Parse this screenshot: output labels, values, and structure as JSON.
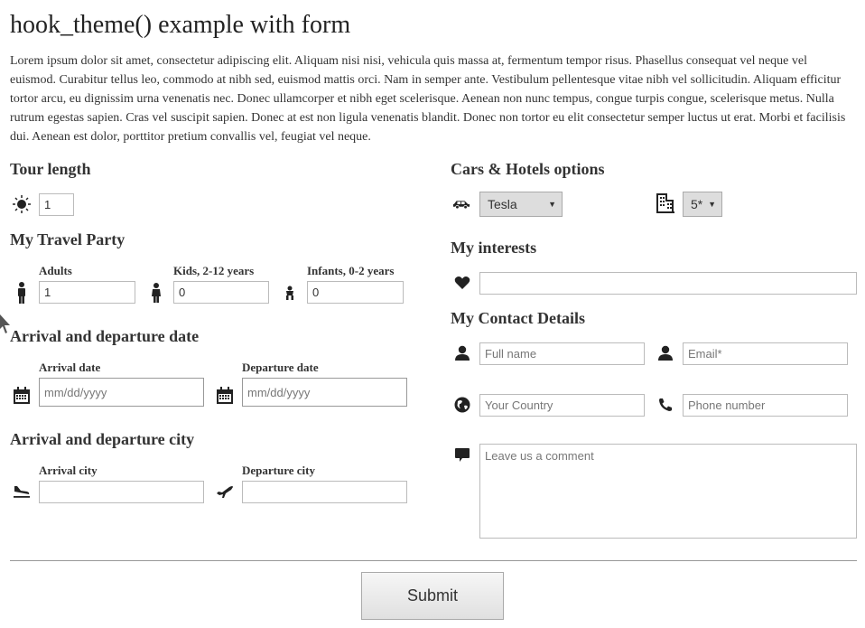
{
  "page": {
    "title": "hook_theme() example with form",
    "intro": "Lorem ipsum dolor sit amet, consectetur adipiscing elit. Aliquam nisi nisi, vehicula quis massa at, fermentum tempor risus. Phasellus consequat vel neque vel euismod. Curabitur tellus leo, commodo at nibh sed, euismod mattis orci. Nam in semper ante. Vestibulum pellentesque vitae nibh vel sollicitudin. Aliquam efficitur tortor arcu, eu dignissim urna venenatis nec. Donec ullamcorper et nibh eget scelerisque. Aenean non nunc tempus, congue turpis congue, scelerisque metus. Nulla rutrum egestas sapien. Cras vel suscipit sapien. Donec at est non ligula venenatis blandit. Donec non tortor eu elit consectetur semper luctus ut erat. Morbi et facilisis dui. Aenean est dolor, porttitor pretium convallis vel, feugiat vel neque."
  },
  "tour": {
    "heading": "Tour length",
    "value": "1"
  },
  "party": {
    "heading": "My Travel Party",
    "adults_label": "Adults",
    "adults_value": "1",
    "kids_label": "Kids, 2-12 years",
    "kids_value": "0",
    "infants_label": "Infants, 0-2 years",
    "infants_value": "0"
  },
  "dates": {
    "heading": "Arrival and departure date",
    "arrival_label": "Arrival date",
    "arrival_value": "mm/dd/yyyy",
    "departure_label": "Departure date",
    "departure_value": "mm/dd/yyyy"
  },
  "city": {
    "heading": "Arrival and departure city",
    "arrival_label": "Arrival city",
    "arrival_value": "",
    "departure_label": "Departure city",
    "departure_value": ""
  },
  "options": {
    "heading": "Cars & Hotels options",
    "car_value": "Tesla",
    "hotel_value": "5*"
  },
  "interests": {
    "heading": "My interests",
    "value": ""
  },
  "contact": {
    "heading": "My Contact Details",
    "fullname_placeholder": "Full name",
    "email_placeholder": "Email*",
    "country_placeholder": "Your Country",
    "phone_placeholder": "Phone number",
    "comment_placeholder": "Leave us a comment"
  },
  "submit_label": "Submit",
  "icons": {
    "sun": "sun-icon",
    "adult": "adult-icon",
    "kid": "child-icon",
    "infant": "baby-icon",
    "calendar": "calendar-icon",
    "landing": "plane-landing-icon",
    "takeoff": "plane-takeoff-icon",
    "car": "car-icon",
    "hotel": "building-icon",
    "heart": "heart-icon",
    "user": "user-icon",
    "globe": "globe-icon",
    "phone": "phone-icon",
    "comment": "comment-icon",
    "cursor": "mouse-cursor-icon"
  }
}
